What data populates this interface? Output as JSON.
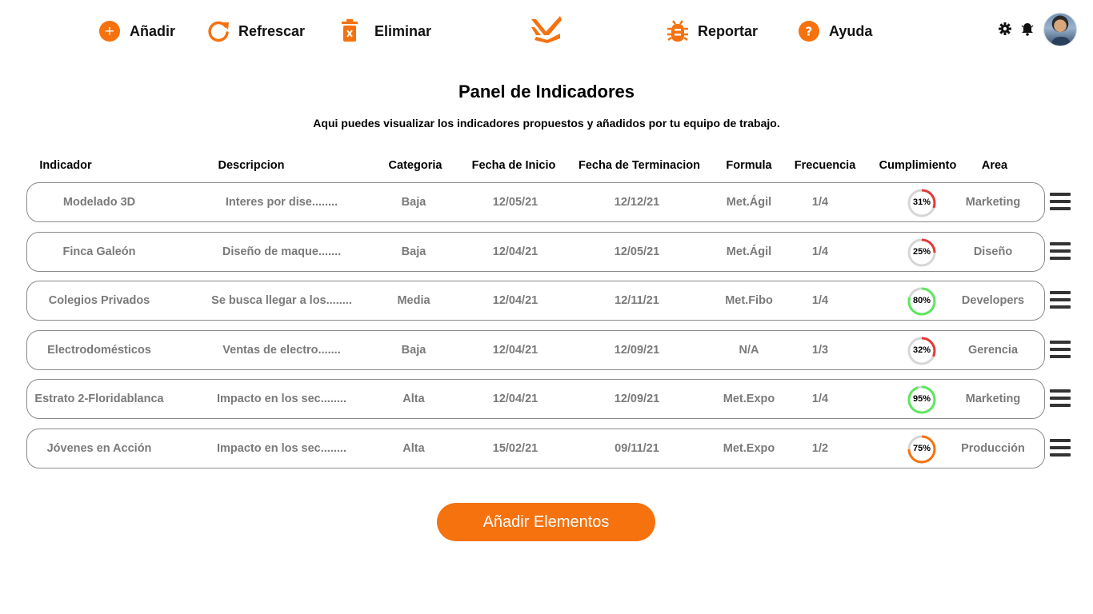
{
  "toolbar": {
    "add_label": "Añadir",
    "refresh_label": "Refrescar",
    "delete_label": "Eliminar",
    "report_label": "Reportar",
    "help_label": "Ayuda",
    "help_glyph": "?",
    "add_glyph": "+",
    "accent_color": "#F5720F"
  },
  "icons": {
    "add": "plus-circle-icon",
    "refresh": "refresh-icon",
    "delete": "trash-icon",
    "logo": "brand-logo",
    "report": "bug-icon",
    "help": "help-circle-icon",
    "settings": "gear-icon",
    "notifications": "bell-icon",
    "user": "avatar"
  },
  "header": {
    "title": "Panel de Indicadores",
    "subtitle": "Aqui puedes visualizar los indicadores propuestos y añadidos por tu equipo de trabajo."
  },
  "table": {
    "columns": [
      "Indicador",
      "Descripcion",
      "Categoria",
      "Fecha de Inicio",
      "Fecha de Terminacion",
      "Formula",
      "Frecuencia",
      "Cumplimiento",
      "Area"
    ],
    "rows": [
      {
        "indicador": "Modelado 3D",
        "descripcion": "Interes por dise........",
        "categoria": "Baja",
        "inicio": "12/05/21",
        "fin": "12/12/21",
        "formula": "Met.Ágil",
        "frecuencia": "1/4",
        "cumplimiento": 31,
        "cumplimiento_label": "31%",
        "ring_color": "#E53935",
        "area": "Marketing"
      },
      {
        "indicador": "Finca Galeón",
        "descripcion": "Diseño de maque.......",
        "categoria": "Baja",
        "inicio": "12/04/21",
        "fin": "12/05/21",
        "formula": "Met.Ágil",
        "frecuencia": "1/4",
        "cumplimiento": 25,
        "cumplimiento_label": "25%",
        "ring_color": "#E53935",
        "area": "Diseño"
      },
      {
        "indicador": "Colegios Privados",
        "descripcion": "Se busca llegar a los........",
        "categoria": "Media",
        "inicio": "12/04/21",
        "fin": "12/11/21",
        "formula": "Met.Fibo",
        "frecuencia": "1/4",
        "cumplimiento": 80,
        "cumplimiento_label": "80%",
        "ring_color": "#5EE65E",
        "area": "Developers"
      },
      {
        "indicador": "Electrodomésticos",
        "descripcion": "Ventas de electro.......",
        "categoria": "Baja",
        "inicio": "12/04/21",
        "fin": "12/09/21",
        "formula": "N/A",
        "frecuencia": "1/3",
        "cumplimiento": 32,
        "cumplimiento_label": "32%",
        "ring_color": "#E53935",
        "area": "Gerencia"
      },
      {
        "indicador": "Estrato 2-Floridablanca",
        "descripcion": "Impacto en los sec........",
        "categoria": "Alta",
        "inicio": "12/04/21",
        "fin": "12/09/21",
        "formula": "Met.Expo",
        "frecuencia": "1/4",
        "cumplimiento": 95,
        "cumplimiento_label": "95%",
        "ring_color": "#5EE65E",
        "area": "Marketing"
      },
      {
        "indicador": "Jóvenes en Acción",
        "descripcion": "Impacto en los sec........",
        "categoria": "Alta",
        "inicio": "15/02/21",
        "fin": "09/11/21",
        "formula": "Met.Expo",
        "frecuencia": "1/2",
        "cumplimiento": 75,
        "cumplimiento_label": "75%",
        "ring_color": "#F5720F",
        "area": "Producción"
      }
    ]
  },
  "cta": {
    "label": "Añadir Elementos"
  }
}
